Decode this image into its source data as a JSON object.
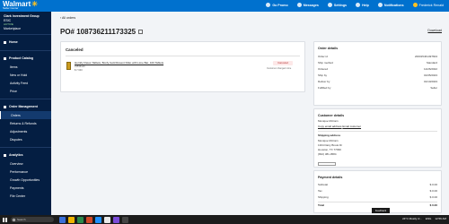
{
  "header": {
    "brand": "Walmart",
    "brand_sub": "Seller Center",
    "nav": [
      {
        "icon": "megaphone-icon",
        "label": "Go Promo"
      },
      {
        "icon": "message-icon",
        "label": "Messages"
      },
      {
        "icon": "gear-icon",
        "label": "Settings"
      },
      {
        "icon": "help-icon",
        "label": "Help"
      },
      {
        "icon": "bell-icon",
        "label": "Notifications"
      }
    ],
    "user": "Frederick Renald"
  },
  "sidebar": {
    "company": "Clark Investment Group",
    "company_sub": "ESIC",
    "status": "ACTIVE",
    "account": "Marketplace",
    "sections": [
      {
        "label": "Home",
        "items": []
      },
      {
        "label": "Product Catalog",
        "items": [
          "Items",
          "New or Hold",
          "Activity Feed",
          "Price"
        ]
      },
      {
        "label": "Order Management",
        "items": [
          "Orders",
          "Returns & Refunds",
          "Adjustments",
          "Disputes"
        ]
      },
      {
        "label": "Analytics",
        "items": [
          "Overview",
          "Performance",
          "Growth Opportunities",
          "Payments",
          "File Center"
        ]
      }
    ],
    "selected": "Orders"
  },
  "page": {
    "back_label": "All orders",
    "po_label": "PO# 108736211173325",
    "download_label": "Download"
  },
  "canceled": {
    "title": "Canceled",
    "item_name": "Hornify Flavor Tablets, Bonfy Gold Rosent Killer with Lime Bar, 100 Tablets",
    "item_sku": "31533140",
    "item_price": "$ 7.640",
    "badge": "Canceled",
    "canceled_by": "Customer changed mine"
  },
  "order_details": {
    "title": "Order details",
    "rows": [
      {
        "label": "Order id",
        "value": "200015461497604"
      },
      {
        "label": "Ship method",
        "value": "Standard"
      },
      {
        "label": "Ordered",
        "value": "12/26/2022"
      },
      {
        "label": "Ship by",
        "value": "01/05/2023"
      },
      {
        "label": "Deliver by",
        "value": "01/10/2023"
      },
      {
        "label": "Fulfilled by",
        "value": "Seller"
      }
    ]
  },
  "customer": {
    "title": "Customer details",
    "name": "Monique McCain",
    "copy_email": "Copy email address",
    "email_customer": "Email customer",
    "shipping_title": "Shipping address",
    "ship_name": "Monique McCain",
    "street": "1304 Dairy Brook Dr",
    "city": "Houston, TX 77099",
    "phone": "(832) 381-0584"
  },
  "payment": {
    "title": "Payment details",
    "rows": [
      {
        "label": "Subtotal",
        "value": "$ 0.00"
      },
      {
        "label": "Tax",
        "value": "$ 0.00"
      },
      {
        "label": "Shipping",
        "value": "$ 0.00"
      },
      {
        "label": "Total",
        "value": "$ 0.00"
      }
    ]
  },
  "feedback_label": "Feedback",
  "taskbar": {
    "search_placeholder": "Search",
    "weather": "24°C  Mostly cl...",
    "time": "12:56 AM",
    "lang": "ENG"
  },
  "colors": {
    "brand_blue": "#0071ce",
    "sidebar_navy": "#041e42",
    "spark_yellow": "#ffc220",
    "canceled_red": "#b32d2e"
  }
}
